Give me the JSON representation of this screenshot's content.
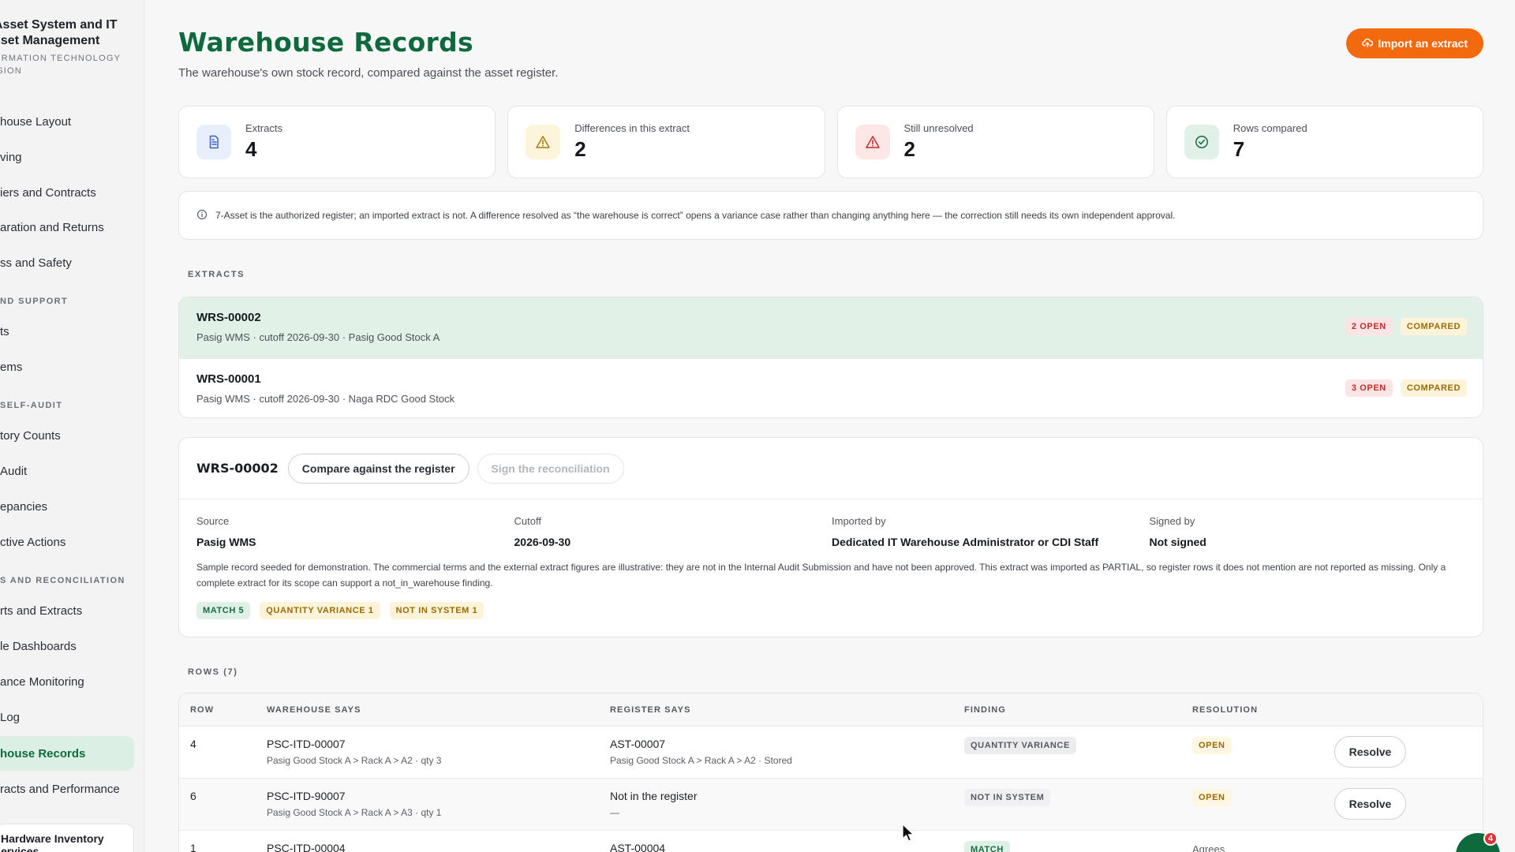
{
  "sidebar": {
    "brand_title_1": "Asset System and IT",
    "brand_title_2": "sset Management",
    "brand_sub_1": "ormation technology",
    "brand_sub_2": "ISION",
    "items": [
      {
        "label": "house Layout",
        "top": 0
      },
      {
        "label": "ving"
      },
      {
        "label": "iers and Contracts"
      },
      {
        "label": "aration and Returns"
      },
      {
        "label": "ss and Safety"
      }
    ],
    "group_support": "ND SUPPORT",
    "support_items": [
      "ts",
      "ems"
    ],
    "group_audit": "SELF-AUDIT",
    "audit_items": [
      "tory Counts",
      "Audit",
      "epancies",
      "ctive Actions"
    ],
    "group_recon": "S AND RECONCILIATION",
    "recon_items": [
      "rts and Extracts",
      "le Dashboards",
      "ance Monitoring",
      " Log",
      "house Records",
      "racts and Performance"
    ],
    "bottom_card": "Hardware Inventory",
    "bottom_card_2": "ervices"
  },
  "header": {
    "title": "Warehouse Records",
    "subtitle": "The warehouse's own stock record, compared against the asset register.",
    "import_label": "Import an extract"
  },
  "stats": [
    {
      "label": "Extracts",
      "value": "4",
      "icon": "document-icon"
    },
    {
      "label": "Differences in this extract",
      "value": "2",
      "icon": "warning-icon"
    },
    {
      "label": "Still unresolved",
      "value": "2",
      "icon": "alert-icon"
    },
    {
      "label": "Rows compared",
      "value": "7",
      "icon": "check-circle-icon"
    }
  ],
  "notice": "7-Asset is the authorized register; an imported extract is not. A difference resolved as “the warehouse is correct” opens a variance case rather than changing anything here — the correction still needs its own independent approval.",
  "extracts_label": "EXTRACTS",
  "extracts": [
    {
      "id": "WRS-00002",
      "meta": "Pasig WMS · cutoff 2026-09-30 · Pasig Good Stock A",
      "open": "2 OPEN",
      "status": "COMPARED"
    },
    {
      "id": "WRS-00001",
      "meta": "Pasig WMS · cutoff 2026-09-30 · Naga RDC Good Stock",
      "open": "3 OPEN",
      "status": "COMPARED"
    }
  ],
  "detail": {
    "id": "WRS-00002",
    "compare_label": "Compare against the register",
    "sign_label": "Sign the reconciliation",
    "fields": [
      {
        "label": "Source",
        "value": "Pasig WMS"
      },
      {
        "label": "Cutoff",
        "value": "2026-09-30"
      },
      {
        "label": "Imported by",
        "value": "Dedicated IT Warehouse Administrator or CDI Staff"
      },
      {
        "label": "Signed by",
        "value": "Not signed"
      }
    ],
    "note": "Sample record seeded for demonstration. The commercial terms and the external extract figures are illustrative: they are not in the Internal Audit Submission and have not been approved. This extract was imported as PARTIAL, so register rows it does not mention are not reported as missing. Only a complete extract for its scope can support a not_in_warehouse finding.",
    "badges": {
      "match": "MATCH 5",
      "qty": "QUANTITY VARIANCE 1",
      "nis": "NOT IN SYSTEM 1"
    }
  },
  "rows_label": "ROWS (7)",
  "table": {
    "headers": {
      "row": "ROW",
      "warehouse": "WAREHOUSE SAYS",
      "register": "REGISTER SAYS",
      "finding": "FINDING",
      "resolution": "RESOLUTION"
    },
    "rows": [
      {
        "row": "4",
        "wh_id": "PSC-ITD-00007",
        "wh_sub": "Pasig Good Stock A > Rack A > A2 · qty 3",
        "reg_id": "AST-00007",
        "reg_sub": "Pasig Good Stock A > Rack A > A2 · Stored",
        "finding": "QUANTITY VARIANCE",
        "resolution": "OPEN",
        "action": "Resolve"
      },
      {
        "row": "6",
        "wh_id": "PSC-ITD-90007",
        "wh_sub": "Pasig Good Stock A > Rack A > A3 · qty 1",
        "reg_id": "Not in the register",
        "reg_sub": "—",
        "finding": "NOT IN SYSTEM",
        "resolution": "OPEN",
        "action": "Resolve"
      },
      {
        "row": "1",
        "wh_id": "PSC-ITD-00004",
        "wh_sub": "",
        "reg_id": "AST-00004",
        "reg_sub": "",
        "finding": "MATCH",
        "resolution": "Agrees",
        "action": ""
      }
    ]
  },
  "chat_badge": "4",
  "colors": {
    "brand_green": "#0e6a3d",
    "accent_orange": "#f26a0d",
    "danger": "#c22c2c",
    "warning": "#9a6b05"
  }
}
